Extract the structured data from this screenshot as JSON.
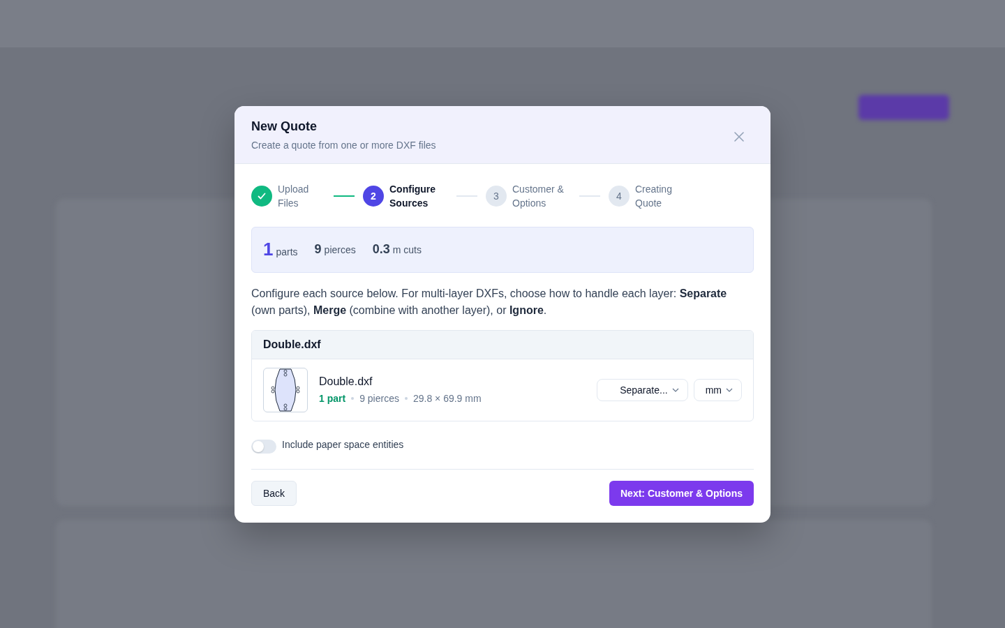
{
  "modal": {
    "title": "New Quote",
    "subtitle": "Create a quote from one or more DXF files"
  },
  "steps": [
    {
      "label": "Upload Files",
      "done": true,
      "selected": false
    },
    {
      "number": "2",
      "label": "Configure Sources",
      "done": false,
      "selected": true
    },
    {
      "number": "3",
      "label": "Customer & Options",
      "done": false,
      "selected": false
    },
    {
      "number": "4",
      "label": "Creating Quote",
      "done": false,
      "selected": false
    }
  ],
  "summary": [
    {
      "value": "1",
      "unit": "parts",
      "kind": "accent"
    },
    {
      "value": "9",
      "unit": "pierces",
      "kind": "plain"
    },
    {
      "value": "0.3",
      "unit": "m cuts",
      "kind": "plain"
    }
  ],
  "instructions": "Configure each source below. For multi-layer DXFs, choose how to handle each layer: **Separate** (own parts), **Merge** (combine with another layer), or **Ignore**.",
  "source": {
    "filename": "Double.dxf",
    "parts": [
      {
        "name": "Double.dxf",
        "count": "1 part",
        "pierces": "9 pierces",
        "size": "29.8 × 69.9 mm",
        "mode": "Separate...",
        "unit": "mm"
      }
    ]
  },
  "paper_space": {
    "label": "Include paper space entities",
    "on": false
  },
  "buttons": {
    "back": "Back",
    "next": "Next: Customer & Options"
  }
}
